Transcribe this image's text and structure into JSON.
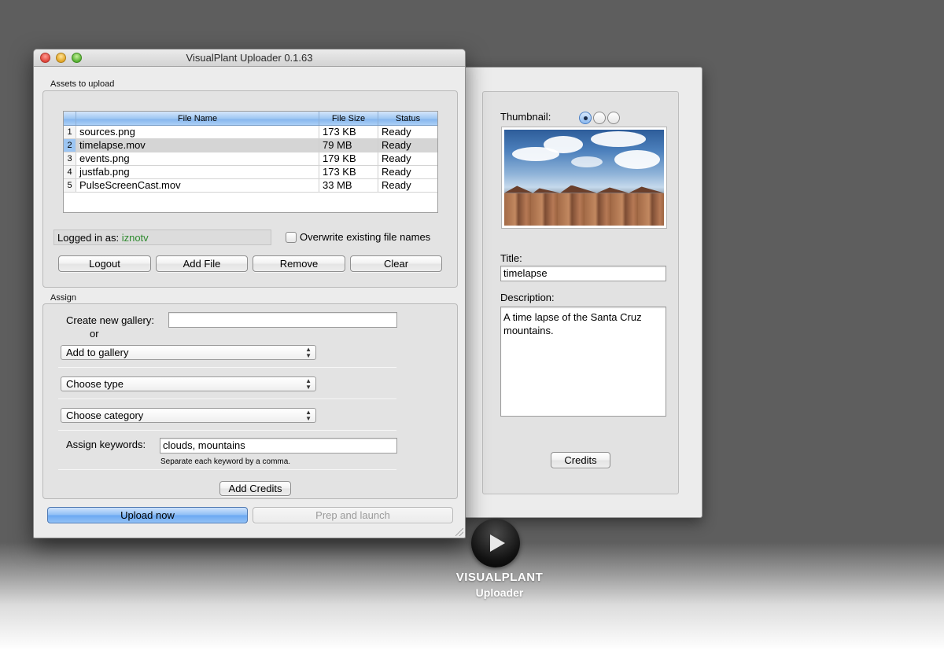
{
  "window": {
    "title": "VisualPlant Uploader 0.1.63"
  },
  "assets": {
    "section_title": "Assets to upload",
    "columns": {
      "name": "File Name",
      "size": "File Size",
      "status": "Status"
    },
    "rows": [
      {
        "index": "1",
        "name": "sources.png",
        "size": "173 KB",
        "status": "Ready"
      },
      {
        "index": "2",
        "name": "timelapse.mov",
        "size": "79 MB",
        "status": "Ready"
      },
      {
        "index": "3",
        "name": "events.png",
        "size": "179 KB",
        "status": "Ready"
      },
      {
        "index": "4",
        "name": "justfab.png",
        "size": "173 KB",
        "status": "Ready"
      },
      {
        "index": "5",
        "name": "PulseScreenCast.mov",
        "size": "33 MB",
        "status": "Ready"
      }
    ],
    "selected_row": 1,
    "logged_in_label": "Logged in as:",
    "username": "iznotv",
    "overwrite_label": "Overwrite existing file names",
    "buttons": {
      "logout": "Logout",
      "add_file": "Add File",
      "remove": "Remove",
      "clear": "Clear"
    }
  },
  "assign": {
    "section_title": "Assign",
    "create_gallery_label": "Create new gallery:",
    "create_gallery_value": "",
    "or_label": "or",
    "gallery_select": "Add to gallery",
    "type_select": "Choose type",
    "category_select": "Choose category",
    "keywords_label": "Assign keywords:",
    "keywords_value": "clouds, mountains",
    "keywords_hint": "Separate each keyword by a comma.",
    "add_credits": "Add Credits"
  },
  "footer": {
    "upload_now": "Upload now",
    "prep_launch": "Prep and launch"
  },
  "details": {
    "thumbnail_label": "Thumbnail:",
    "title_label": "Title:",
    "title_value": "timelapse",
    "description_label": "Description:",
    "description_value": "A time lapse of the Santa Cruz mountains.",
    "credits": "Credits"
  },
  "branding": {
    "name": "VISUALPLANT",
    "sub": "Uploader"
  },
  "colors": {
    "username": "#2e8a2e",
    "accent": "#6aa8f2"
  }
}
